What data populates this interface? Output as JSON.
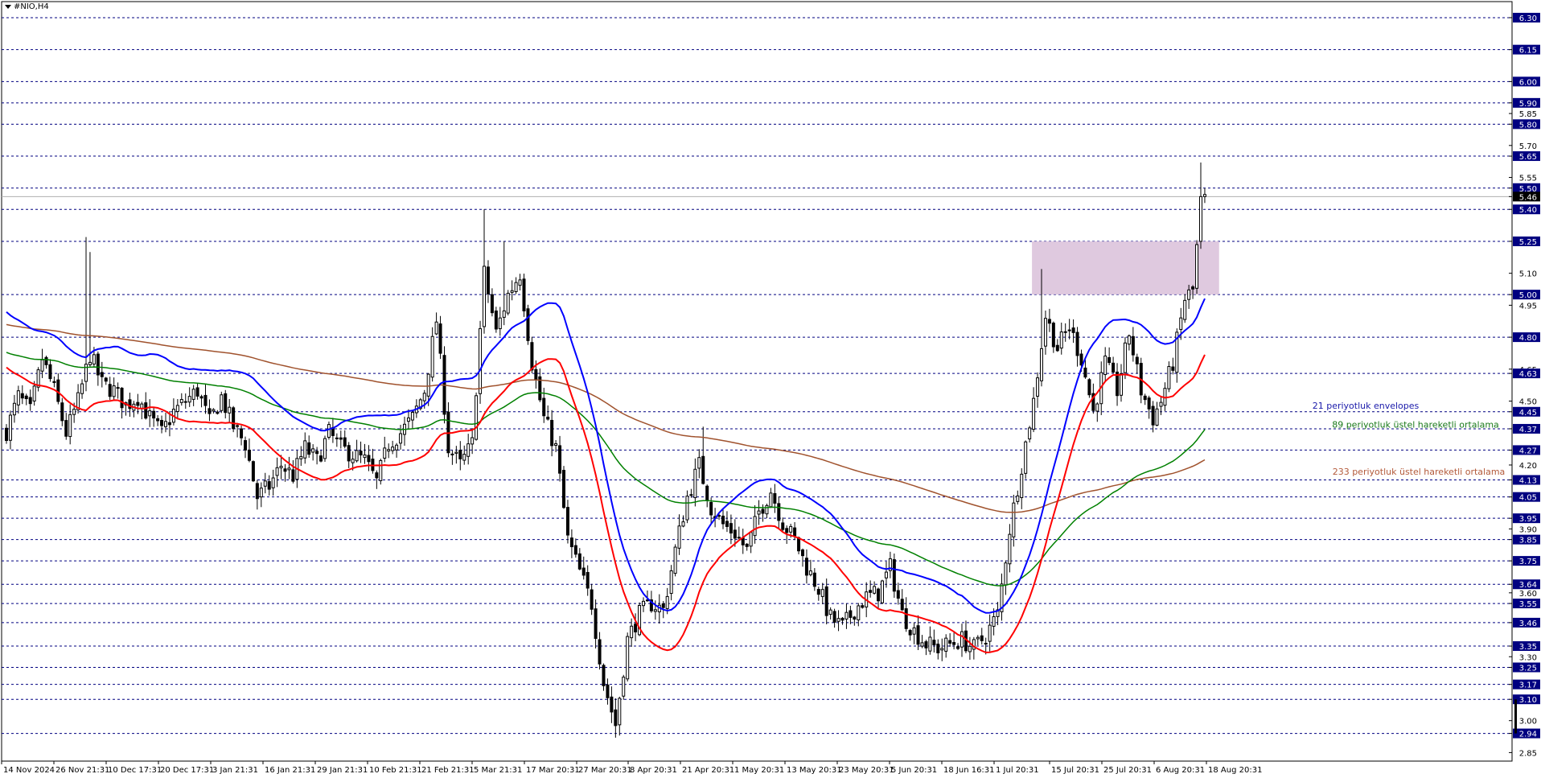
{
  "symbol": "#NIO,H4",
  "chart_data": {
    "type": "candlestick",
    "symbol": "#NIO,H4",
    "current_price": 5.46,
    "y_range": [
      2.81,
      6.33
    ],
    "grid_levels": [
      6.3,
      6.15,
      6.0,
      5.9,
      5.8,
      5.65,
      5.5,
      5.4,
      5.25,
      5.0,
      4.8,
      4.63,
      4.45,
      4.37,
      4.27,
      4.13,
      4.05,
      3.95,
      3.85,
      3.75,
      3.64,
      3.55,
      3.46,
      3.35,
      3.25,
      3.17,
      3.1,
      2.94
    ],
    "axis_labels": [
      {
        "value": 6.3,
        "text": "6.30",
        "boxed": true
      },
      {
        "value": 6.15,
        "text": "6.15",
        "boxed": true
      },
      {
        "value": 6.0,
        "text": "6.00",
        "boxed": true
      },
      {
        "value": 5.9,
        "text": "5.90",
        "boxed": true
      },
      {
        "value": 5.85,
        "text": "5.85",
        "boxed": false
      },
      {
        "value": 5.8,
        "text": "5.80",
        "boxed": true
      },
      {
        "value": 5.7,
        "text": "5.70",
        "boxed": false
      },
      {
        "value": 5.65,
        "text": "5.65",
        "boxed": true
      },
      {
        "value": 5.55,
        "text": "5.55",
        "boxed": false
      },
      {
        "value": 5.5,
        "text": "5.50",
        "boxed": true
      },
      {
        "value": 5.46,
        "text": "5.46",
        "boxed": true,
        "current": true
      },
      {
        "value": 5.4,
        "text": "5.40",
        "boxed": true
      },
      {
        "value": 5.25,
        "text": "5.25",
        "boxed": true
      },
      {
        "value": 5.1,
        "text": "5.10",
        "boxed": false
      },
      {
        "value": 5.0,
        "text": "5.00",
        "boxed": true
      },
      {
        "value": 4.95,
        "text": "4.95",
        "boxed": false
      },
      {
        "value": 4.8,
        "text": "4.80",
        "boxed": true
      },
      {
        "value": 4.65,
        "text": "4.65",
        "boxed": false
      },
      {
        "value": 4.63,
        "text": "4.63",
        "boxed": true
      },
      {
        "value": 4.5,
        "text": "4.50",
        "boxed": false
      },
      {
        "value": 4.45,
        "text": "4.45",
        "boxed": true
      },
      {
        "value": 4.37,
        "text": "4.37",
        "boxed": true
      },
      {
        "value": 4.27,
        "text": "4.27",
        "boxed": true
      },
      {
        "value": 4.2,
        "text": "4.20",
        "boxed": false
      },
      {
        "value": 4.13,
        "text": "4.13",
        "boxed": true
      },
      {
        "value": 4.05,
        "text": "4.05",
        "boxed": true
      },
      {
        "value": 3.95,
        "text": "3.95",
        "boxed": true
      },
      {
        "value": 3.9,
        "text": "3.90",
        "boxed": false
      },
      {
        "value": 3.85,
        "text": "3.85",
        "boxed": true
      },
      {
        "value": 3.75,
        "text": "3.75",
        "boxed": true
      },
      {
        "value": 3.64,
        "text": "3.64",
        "boxed": true
      },
      {
        "value": 3.6,
        "text": "3.60",
        "boxed": false
      },
      {
        "value": 3.55,
        "text": "3.55",
        "boxed": true
      },
      {
        "value": 3.46,
        "text": "3.46",
        "boxed": true
      },
      {
        "value": 3.35,
        "text": "3.35",
        "boxed": true
      },
      {
        "value": 3.3,
        "text": "3.30",
        "boxed": false
      },
      {
        "value": 3.25,
        "text": "3.25",
        "boxed": true
      },
      {
        "value": 3.17,
        "text": "3.17",
        "boxed": true
      },
      {
        "value": 3.1,
        "text": "3.10",
        "boxed": true
      },
      {
        "value": 3.0,
        "text": "3.00",
        "boxed": false
      },
      {
        "value": 2.94,
        "text": "2.94",
        "boxed": true
      },
      {
        "value": 2.85,
        "text": "2.85",
        "boxed": false
      }
    ],
    "x_labels": [
      "14 Nov 2024",
      "26 Nov 21:31",
      "10 Dec 17:31",
      "20 Dec 17:31",
      "3 Jan 21:31",
      "16 Jan 21:31",
      "29 Jan 21:31",
      "10 Feb 21:31",
      "21 Feb 21:31",
      "5 Mar 21:31",
      "17 Mar 20:31",
      "27 Mar 20:31",
      "8 Apr 20:31",
      "21 Apr 20:31",
      "1 May 20:31",
      "13 May 20:31",
      "23 May 20:31",
      "5 Jun 20:31",
      "18 Jun 16:31",
      "1 Jul 20:31",
      "15 Jul 20:31",
      "25 Jul 20:31",
      "6 Aug 20:31",
      "18 Aug 20:31"
    ],
    "zone": {
      "low": 5.0,
      "high": 5.25,
      "from_bar": 258,
      "to_bar": 305,
      "color": "#d9bfd9"
    },
    "annotations": [
      {
        "text": "21 periyotluk envelopes",
        "color": "#1a1aaa",
        "price": 4.48
      },
      {
        "text": "89 periyotluk üstel hareketli ortalama",
        "color": "#1a7a1a",
        "price": 4.39
      },
      {
        "text": "233 periyotluk üstel hareketli ortalama",
        "color": "#b35a3a",
        "price": 4.17
      }
    ],
    "series_colors": {
      "envelope_upper": "#0000ff",
      "envelope_lower": "#ff0000",
      "ema89": "#008000",
      "ema233": "#a0522d",
      "candles": "#000000"
    },
    "anchors": [
      [
        0,
        4.36
      ],
      [
        3,
        4.52
      ],
      [
        6,
        4.45
      ],
      [
        9,
        4.7
      ],
      [
        12,
        4.55
      ],
      [
        15,
        4.35
      ],
      [
        18,
        4.5
      ],
      [
        21,
        4.72
      ],
      [
        24,
        4.58
      ],
      [
        27,
        4.55
      ],
      [
        30,
        4.48
      ],
      [
        33,
        4.52
      ],
      [
        36,
        4.42
      ],
      [
        39,
        4.35
      ],
      [
        42,
        4.45
      ],
      [
        45,
        4.5
      ],
      [
        48,
        4.55
      ],
      [
        51,
        4.4
      ],
      [
        54,
        4.52
      ],
      [
        57,
        4.38
      ],
      [
        60,
        4.3
      ],
      [
        63,
        4.05
      ],
      [
        66,
        4.1
      ],
      [
        69,
        4.2
      ],
      [
        72,
        4.15
      ],
      [
        75,
        4.28
      ],
      [
        78,
        4.22
      ],
      [
        81,
        4.35
      ],
      [
        84,
        4.28
      ],
      [
        87,
        4.25
      ],
      [
        90,
        4.22
      ],
      [
        93,
        4.12
      ],
      [
        96,
        4.3
      ],
      [
        99,
        4.35
      ],
      [
        102,
        4.42
      ],
      [
        105,
        4.55
      ],
      [
        108,
        4.88
      ],
      [
        111,
        4.28
      ],
      [
        114,
        4.2
      ],
      [
        117,
        4.3
      ],
      [
        120,
        5.1
      ],
      [
        123,
        4.82
      ],
      [
        126,
        5.0
      ],
      [
        129,
        5.1
      ],
      [
        132,
        4.68
      ],
      [
        135,
        4.42
      ],
      [
        138,
        4.28
      ],
      [
        141,
        3.85
      ],
      [
        144,
        3.7
      ],
      [
        147,
        3.55
      ],
      [
        150,
        3.18
      ],
      [
        153,
        2.98
      ],
      [
        156,
        3.38
      ],
      [
        159,
        3.5
      ],
      [
        162,
        3.55
      ],
      [
        165,
        3.52
      ],
      [
        168,
        3.8
      ],
      [
        171,
        4.05
      ],
      [
        174,
        4.2
      ],
      [
        177,
        4.0
      ],
      [
        180,
        3.92
      ],
      [
        183,
        3.88
      ],
      [
        186,
        3.8
      ],
      [
        189,
        3.98
      ],
      [
        192,
        4.08
      ],
      [
        195,
        3.93
      ],
      [
        198,
        3.85
      ],
      [
        201,
        3.72
      ],
      [
        204,
        3.62
      ],
      [
        207,
        3.48
      ],
      [
        210,
        3.44
      ],
      [
        213,
        3.52
      ],
      [
        216,
        3.58
      ],
      [
        219,
        3.6
      ],
      [
        222,
        3.72
      ],
      [
        225,
        3.5
      ],
      [
        228,
        3.42
      ],
      [
        231,
        3.36
      ],
      [
        234,
        3.34
      ],
      [
        237,
        3.36
      ],
      [
        240,
        3.38
      ],
      [
        243,
        3.34
      ],
      [
        246,
        3.4
      ],
      [
        249,
        3.5
      ],
      [
        252,
        3.9
      ],
      [
        255,
        4.2
      ],
      [
        258,
        4.5
      ],
      [
        261,
        4.9
      ],
      [
        264,
        4.75
      ],
      [
        267,
        4.85
      ],
      [
        270,
        4.7
      ],
      [
        273,
        4.45
      ],
      [
        276,
        4.68
      ],
      [
        279,
        4.55
      ],
      [
        282,
        4.82
      ],
      [
        285,
        4.55
      ],
      [
        288,
        4.42
      ],
      [
        290,
        4.5
      ],
      [
        293,
        4.68
      ],
      [
        296,
        4.98
      ],
      [
        298,
        5.02
      ],
      [
        300,
        5.42
      ]
    ]
  }
}
